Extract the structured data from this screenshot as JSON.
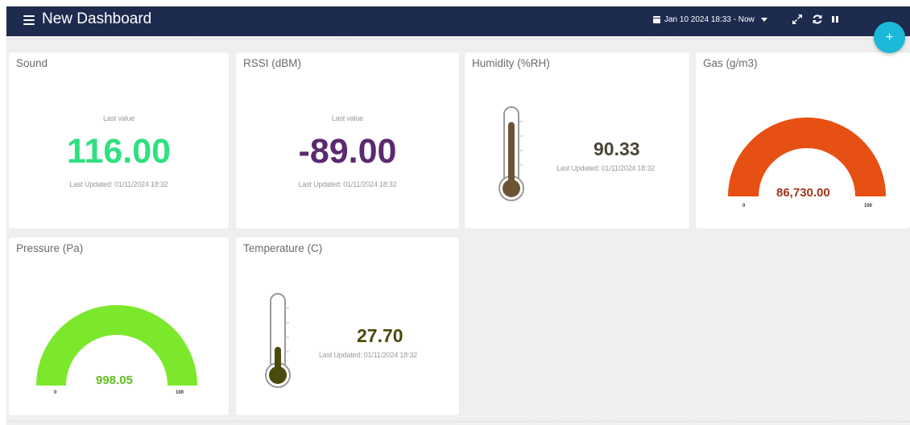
{
  "topbar": {
    "title": "New Dashboard",
    "date_range": "Jan 10 2024 18:33 - Now"
  },
  "colors": {
    "topbar_bg": "#1d2b4f",
    "fab": "#1cb8d8",
    "sound": "#2ee07f",
    "rssi": "#5a2970",
    "thermo": "#6b5436",
    "temperature": "#4a4a0f",
    "gas_gauge": "#e65012",
    "gas_value": "#a2341b",
    "pressure_gauge": "#7ce82c",
    "pressure_value": "#5fbd1e"
  },
  "widgets": {
    "sound": {
      "title": "Sound",
      "label": "Last value",
      "value": "116.00",
      "updated": "Last Updated: 01/11/2024 18:32"
    },
    "rssi": {
      "title": "RSSI (dBM)",
      "label": "Last value",
      "value": "-89.00",
      "updated": "Last Updated: 01/11/2024 18:32"
    },
    "humidity": {
      "title": "Humidity (%RH)",
      "value": "90.33",
      "updated": "Last Updated: 01/11/2024 18:32",
      "fill_fraction": 0.9
    },
    "gas": {
      "title": "Gas (g/m3)",
      "value": "86,730.00",
      "min": "0",
      "max": "100"
    },
    "pressure": {
      "title": "Pressure (Pa)",
      "value": "998.05",
      "min": "0",
      "max": "100"
    },
    "temperature": {
      "title": "Temperature (C)",
      "value": "27.70",
      "updated": "Last Updated: 01/11/2024 18:32",
      "fill_fraction": 0.35
    }
  }
}
